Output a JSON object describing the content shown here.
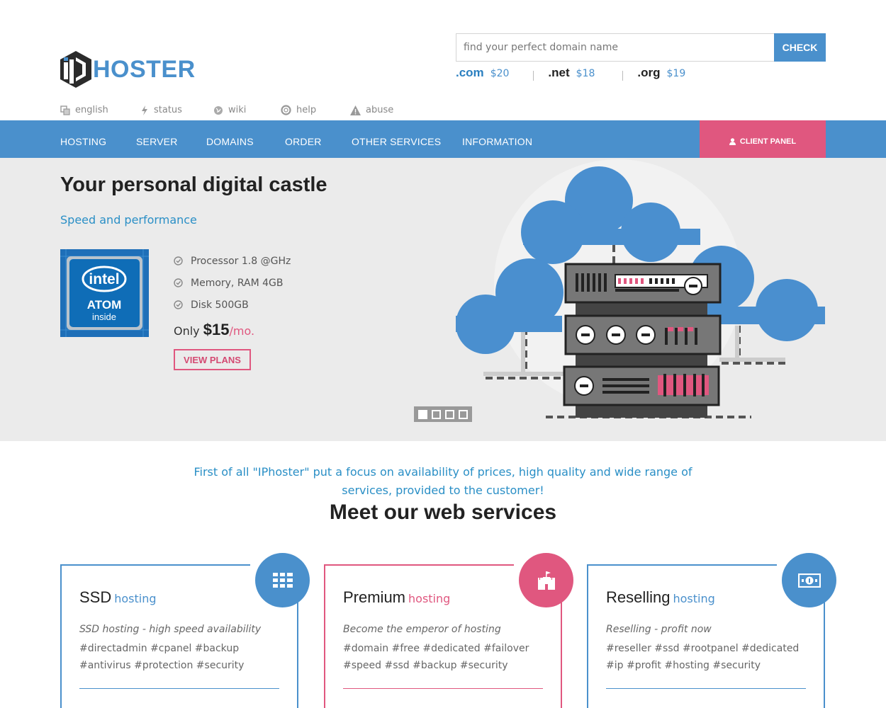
{
  "brand": {
    "name": "HOSTER",
    "accent": "#4a90cc",
    "pink": "#e0577f"
  },
  "domain_search": {
    "placeholder": "find your perfect domain name",
    "button": "CHECK",
    "tlds": [
      {
        "name": ".com",
        "price": "$20"
      },
      {
        "name": ".net",
        "price": "$18"
      },
      {
        "name": ".org",
        "price": "$19"
      }
    ]
  },
  "util_nav": [
    {
      "label": "english",
      "icon": "translate-icon"
    },
    {
      "label": "status",
      "icon": "bolt-icon"
    },
    {
      "label": "wiki",
      "icon": "globe-icon"
    },
    {
      "label": "help",
      "icon": "lifebuoy-icon"
    },
    {
      "label": "abuse",
      "icon": "warning-icon"
    }
  ],
  "main_nav": [
    "HOSTING",
    "SERVER",
    "DOMAINS",
    "ORDER",
    "OTHER SERVICES",
    "INFORMATION"
  ],
  "client_panel": "CLIENT PANEL",
  "hero": {
    "title": "Your personal digital castle",
    "subtitle": "Speed and performance",
    "chip": {
      "brand": "intel",
      "model": "ATOM",
      "tag": "inside"
    },
    "specs": [
      "Processor 1.8 @GHz",
      "Memory, RAM 4GB",
      "Disk 500GB"
    ],
    "price_prefix": "Only",
    "price": "$15",
    "price_suffix": "/mo.",
    "cta": "VIEW PLANS",
    "slides": 4,
    "active_slide": 1
  },
  "intro": "First of all \"IPhoster\" put a focus on availability of prices, high quality and wide range of services, provided to the customer!",
  "section_title": "Meet our web services",
  "cards": [
    {
      "title": "SSD",
      "subtitle": "hosting",
      "icon": "grid-icon",
      "color": "#4a90cc",
      "description": "SSD hosting - high speed availability",
      "tags": "#directadmin #cpanel #backup #antivirus #protection #security"
    },
    {
      "title": "Premium",
      "subtitle": "hosting",
      "icon": "castle-icon",
      "color": "#e0577f",
      "description": "Become the emperor of hosting",
      "tags": "#domain #free #dedicated #failover #speed #ssd #backup #security"
    },
    {
      "title": "Reselling",
      "subtitle": "hosting",
      "icon": "money-icon",
      "color": "#4a90cc",
      "description": "Reselling - profit now",
      "tags": "#reseller #ssd #rootpanel #dedicated #ip #profit #hosting #security"
    }
  ]
}
